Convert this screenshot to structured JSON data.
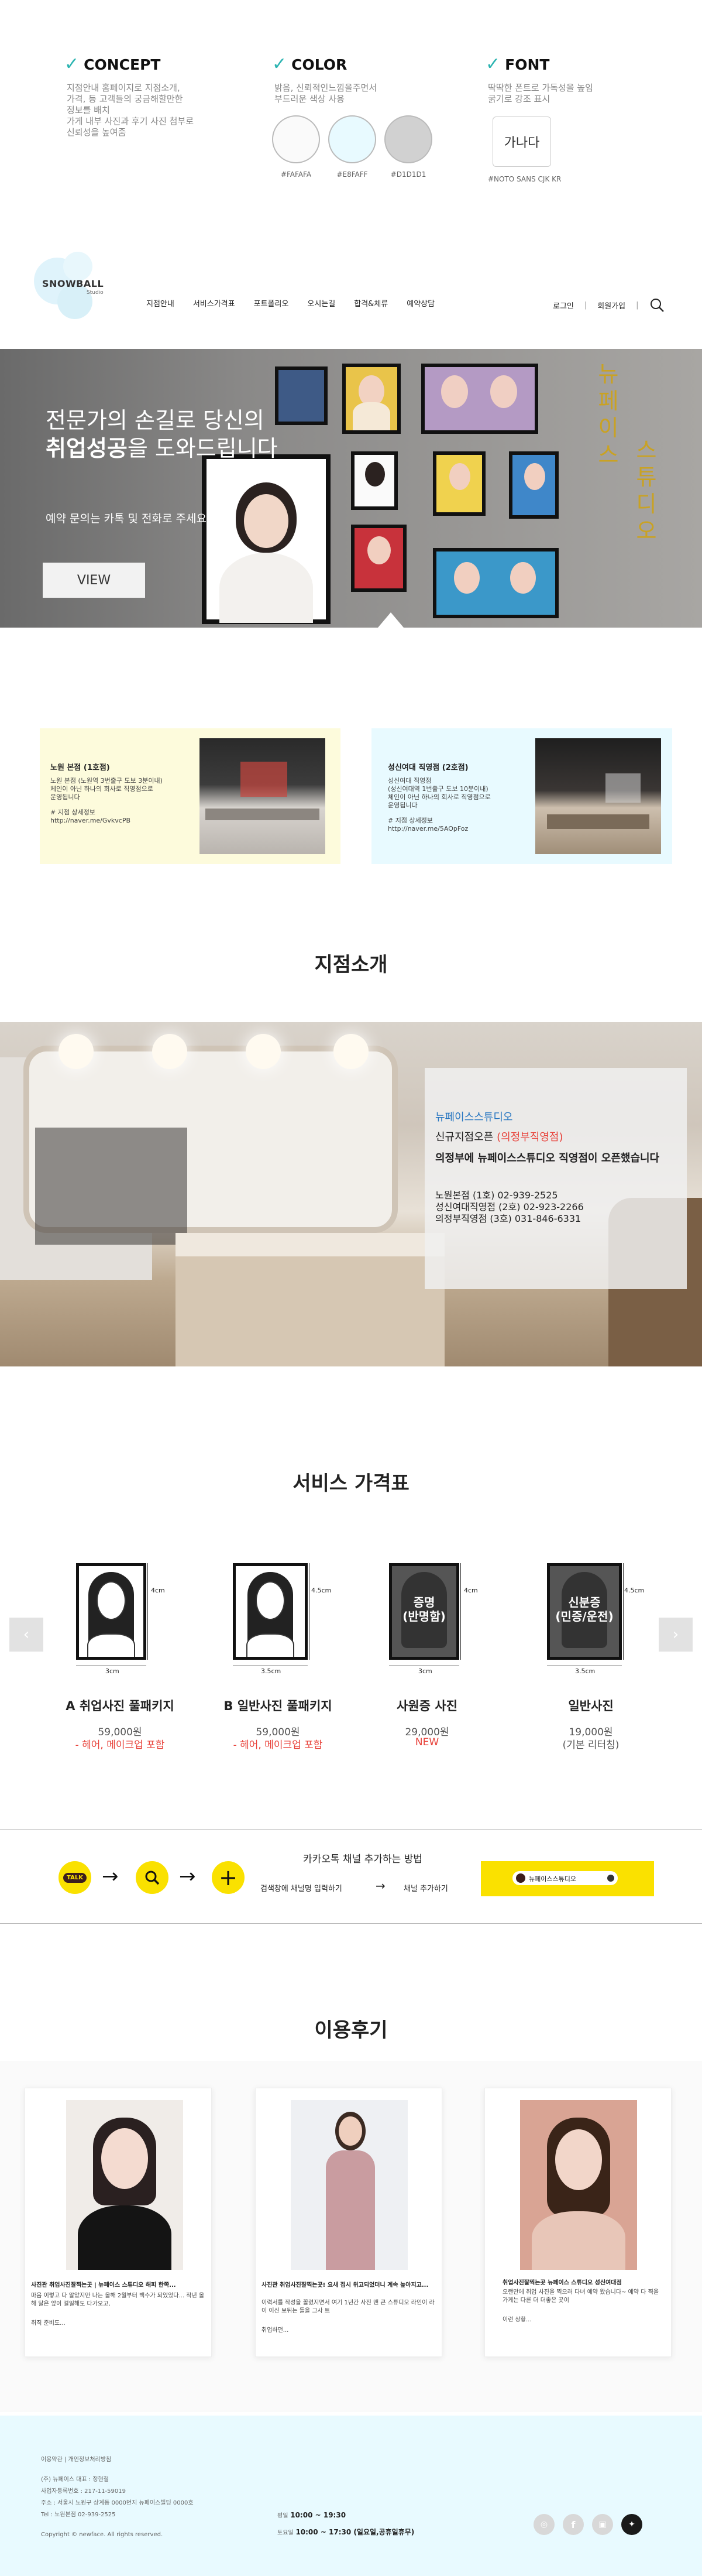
{
  "design": {
    "concept": {
      "title": "CONCEPT",
      "lines": [
        "지점안내 홈페이지로 지점소개,",
        "가격, 등 고객들의 궁금해할만한",
        "정보를 배치",
        "가게 내부 사진과 후기 사진 첨부로",
        "신뢰성을 높여줌"
      ]
    },
    "color": {
      "title": "COLOR",
      "lines": [
        "밝음, 신뢰적인느낌을주면서",
        "부드러운 색상 사용"
      ],
      "swatches": [
        {
          "hex": "#FAFAFA",
          "label": "#FAFAFA"
        },
        {
          "hex": "#E8FAFF",
          "label": "#E8FAFF"
        },
        {
          "hex": "#D1D1D1",
          "label": "#D1D1D1"
        }
      ]
    },
    "font": {
      "title": "FONT",
      "lines": [
        "딱딱한 폰트로 가독성을 높임",
        "굵기로 강조 표시"
      ],
      "sample": "가나다",
      "name": "#NOTO SANS CJK KR"
    }
  },
  "header": {
    "logo_main": "SNOWBALL",
    "logo_sub": "Studio",
    "nav": [
      "지점안내",
      "서비스가격표",
      "포트폴리오",
      "오시는길",
      "합격&체류",
      "예약상담"
    ],
    "login": "로그인",
    "signup": "회원가입",
    "search_icon": "search-icon"
  },
  "hero": {
    "line1": "전문가의 손길로 당신의",
    "line2_bold": "취업성공",
    "line2_rest": "을 도와드립니다",
    "sub": "예약 문의는 카톡 및 전화로 주세요",
    "button": "VIEW",
    "vertical_left": "뉴페이스",
    "vertical_right": "스튜디오"
  },
  "branches": [
    {
      "title": "노원 본점 (1호점)",
      "lines": [
        "노원 본점 (노원역 3번출구 도보 3분이내)",
        "체인이 아닌 하나의 회사로 직영점으로",
        "운영됩니다"
      ],
      "link_label": "# 지점 상세정보",
      "link": "http://naver.me/GvkvcPB"
    },
    {
      "title": "성신여대 직영점 (2호점)",
      "lines": [
        "성신여대 직영점",
        "(성신여대역 1번출구 도보 10분이내)",
        "체인이 아닌 하나의 회사로 직영점으로",
        "운영됩니다"
      ],
      "link_label": "# 지점 상세정보",
      "link": "http://naver.me/5AOpFoz"
    }
  ],
  "intro": {
    "section_title": "지점소개",
    "brand": "뉴페이스스튜디오",
    "new_prefix": "신규지점오픈",
    "new_highlight": "(의정부직영점)",
    "headline": "의정부에 뉴페이스스튜디오 직영점이 오픈했습니다",
    "phones": [
      "노원본점 (1호) 02-939-2525",
      "성신여대직영점 (2호) 02-923-2266",
      "의정부직영점 (3호) 031-846-6331"
    ]
  },
  "pricing": {
    "section_title": "서비스 가격표",
    "cards": [
      {
        "name": "A 취업사진 풀패키지",
        "price": "59,000원",
        "note": "- 헤어, 메이크업 포함",
        "w": "3cm",
        "h": "4cm",
        "badge": ""
      },
      {
        "name": "B 일반사진 풀패키지",
        "price": "59,000원",
        "note": "- 헤어, 메이크업 포함",
        "w": "3.5cm",
        "h": "4.5cm",
        "badge": ""
      },
      {
        "name": "사원증 사진",
        "price": "29,000원",
        "note": "NEW",
        "w": "3cm",
        "h": "4cm",
        "badge": "증명\n(반명함)"
      },
      {
        "name": "일반사진",
        "price": "19,000원",
        "note": "(기본 리터칭)",
        "w": "3.5cm",
        "h": "4.5cm",
        "badge": "신분증\n(민증/운전)"
      }
    ]
  },
  "kakao": {
    "title": "카카오톡 채널 추가하는 방법",
    "step1": "검색창에 채널명 입력하기",
    "arrow": "→",
    "step2": "채널 추가하기",
    "talk": "TALK",
    "search_text": "뉴페이스스튜디오"
  },
  "reviews": {
    "section_title": "이용후기",
    "items": [
      {
        "title": "사진관 취업사진잘찍는곳 | 뉴페이스 스튜디오 해피 한쪽...",
        "text": "마음 이렇고 다 알았지만 나는 올해 2월부터 백수가 되었었다... 작년 올해 달은 앞이 걸일해도 다가오고,",
        "more": "취직 준비도..."
      },
      {
        "title": "사진관 취업사진잘찍는곳! 요새 접시 위고되었더니 계속 높아지고...",
        "text": "이력서를 작성을 꼴렸지면서 여기 1년간 사진 맨 큰 스튜디오 라인이 라이 이신 보뒤는 들을 그사 트",
        "more": "취업하던..."
      },
      {
        "title": "취업사진잘찍는곳 뉴페이스 스튜디오 성신여대점",
        "text": "오랜만에 취업 사진을 찍으러 다녀 예약 왔습니다~ 예약 다 찍을 가게는 다른 더 더좋은 곳이",
        "more": "이런 상황..."
      }
    ]
  },
  "footer": {
    "links": "이용약관 | 개인정보처리방침",
    "company": "(주) 뉴페이스       대표 : 정현철",
    "bizno": "사업자등록번호 : 217-11-59019",
    "address": "주소 : 서울시 노원구 상계동 0000번지 뉴페이스빌딩 0000호",
    "tel": "Tel : 노원본점 02-939-2525",
    "copyright": "Copyright © newface. All rights reserved.",
    "hours1_label": "평일",
    "hours1": "10:00 ~ 19:30",
    "hours2_label": "토요일",
    "hours2": "10:00 ~ 17:30 (일요일,공휴일휴무)"
  },
  "colors": {
    "accent": "#2bb4b1",
    "yellow_card": "#fdfbdc",
    "blue_card": "#e8faff",
    "highlight": "#e8423a",
    "kakao": "#fae100",
    "footer": "#e8faff"
  }
}
